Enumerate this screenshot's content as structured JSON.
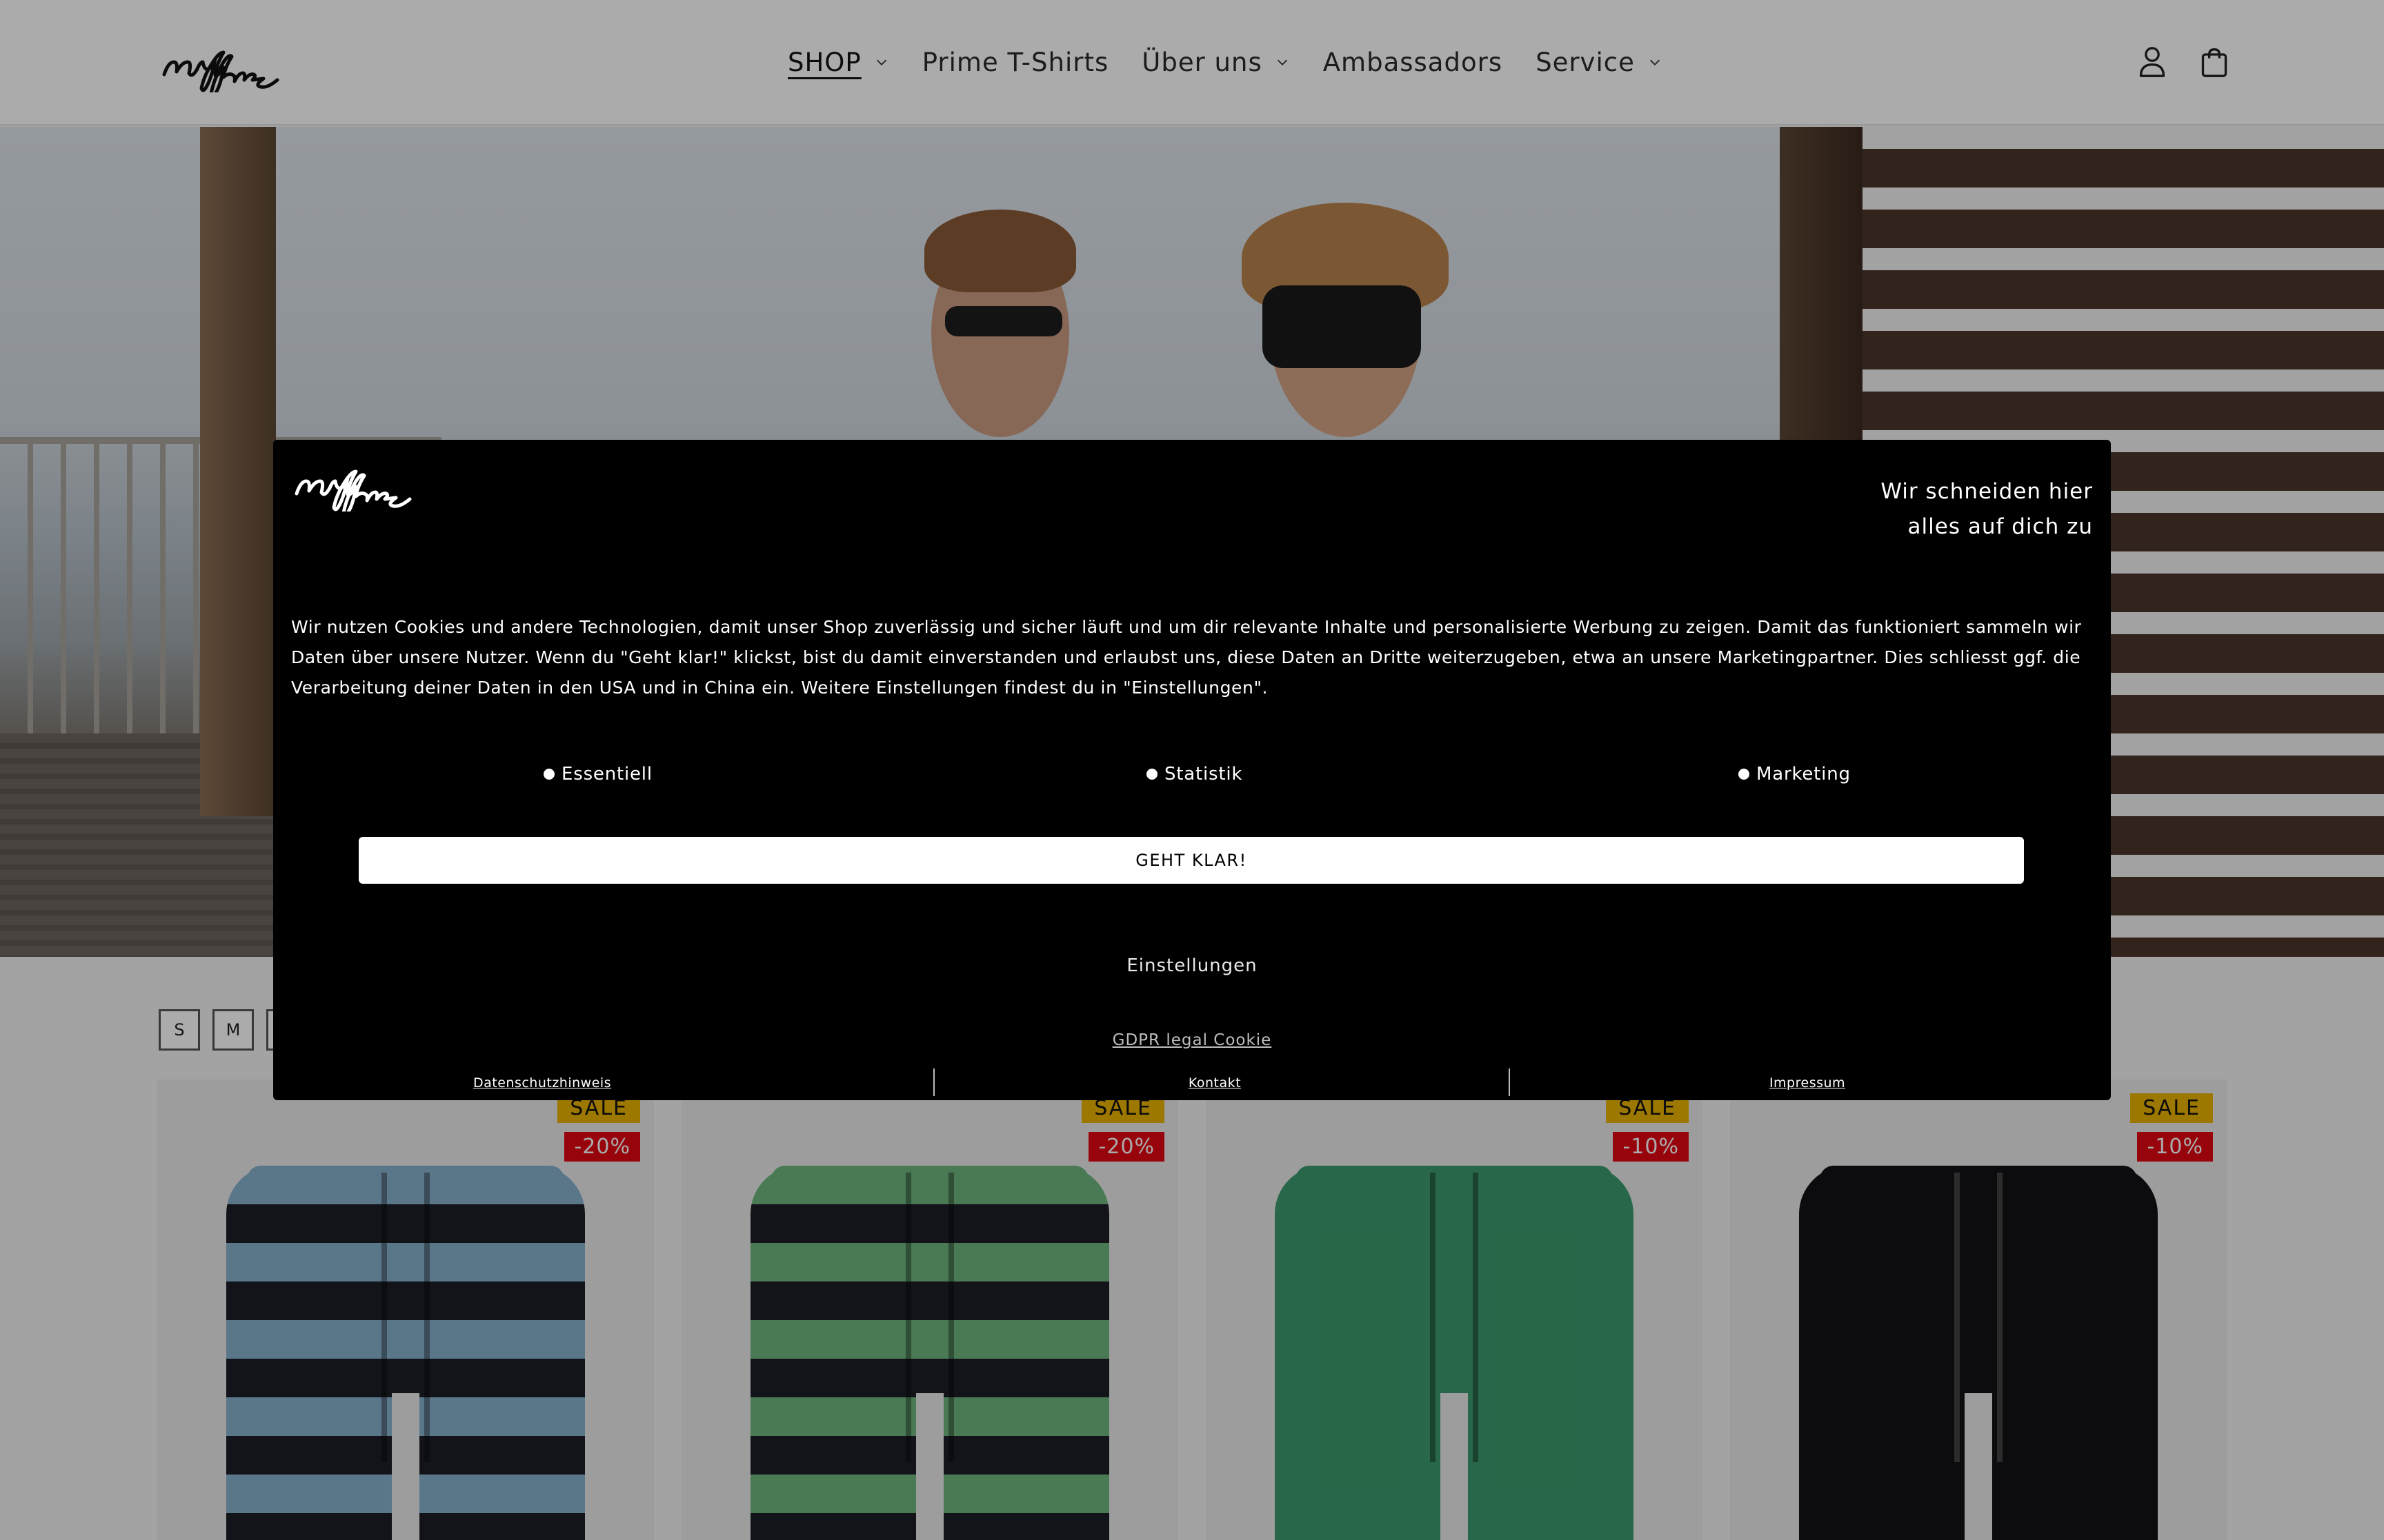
{
  "header": {
    "brand": "nuffinz",
    "nav": [
      {
        "label": "SHOP",
        "has_dropdown": true,
        "active": true
      },
      {
        "label": "Prime T-Shirts",
        "has_dropdown": false
      },
      {
        "label": "Über uns",
        "has_dropdown": true
      },
      {
        "label": "Ambassadors",
        "has_dropdown": false
      },
      {
        "label": "Service",
        "has_dropdown": true
      }
    ],
    "icons": [
      "account-icon",
      "cart-icon"
    ]
  },
  "filters": {
    "sizes": [
      "S",
      "M",
      ""
    ]
  },
  "products": [
    {
      "badge": "SALE",
      "discount": "-20%",
      "color": "stripe-blue"
    },
    {
      "badge": "SALE",
      "discount": "-20%",
      "color": "stripe-green"
    },
    {
      "badge": "SALE",
      "discount": "-10%",
      "color": "solid-green"
    },
    {
      "badge": "SALE",
      "discount": "-10%",
      "color": "solid-black"
    }
  ],
  "cookie": {
    "brand": "nuffinz",
    "tagline_line1": "Wir schneiden hier",
    "tagline_line2": "alles auf dich zu",
    "body": "Wir nutzen Cookies und andere Technologien, damit unser Shop zuverlässig und sicher läuft und um dir relevante Inhalte und personalisierte Werbung zu zeigen. Damit das funktioniert sammeln wir Daten über unsere Nutzer. Wenn du \"Geht klar!\" klickst, bist du damit einverstanden und erlaubst uns, diese Daten an Dritte weiterzugeben, etwa an unsere Marketingpartner. Dies schliesst ggf. die Verarbeitung deiner Daten in den USA und in China ein. Weitere Einstellungen findest du in \"Einstellungen\".",
    "toggles": [
      "Essentiell",
      "Statistik",
      "Marketing"
    ],
    "accept_label": "GEHT KLAR!",
    "settings_label": "Einstellungen",
    "gdpr_label": "GDPR legal Cookie",
    "footer_links": [
      "Datenschutzhinweis",
      "Kontakt",
      "Impressum"
    ]
  }
}
